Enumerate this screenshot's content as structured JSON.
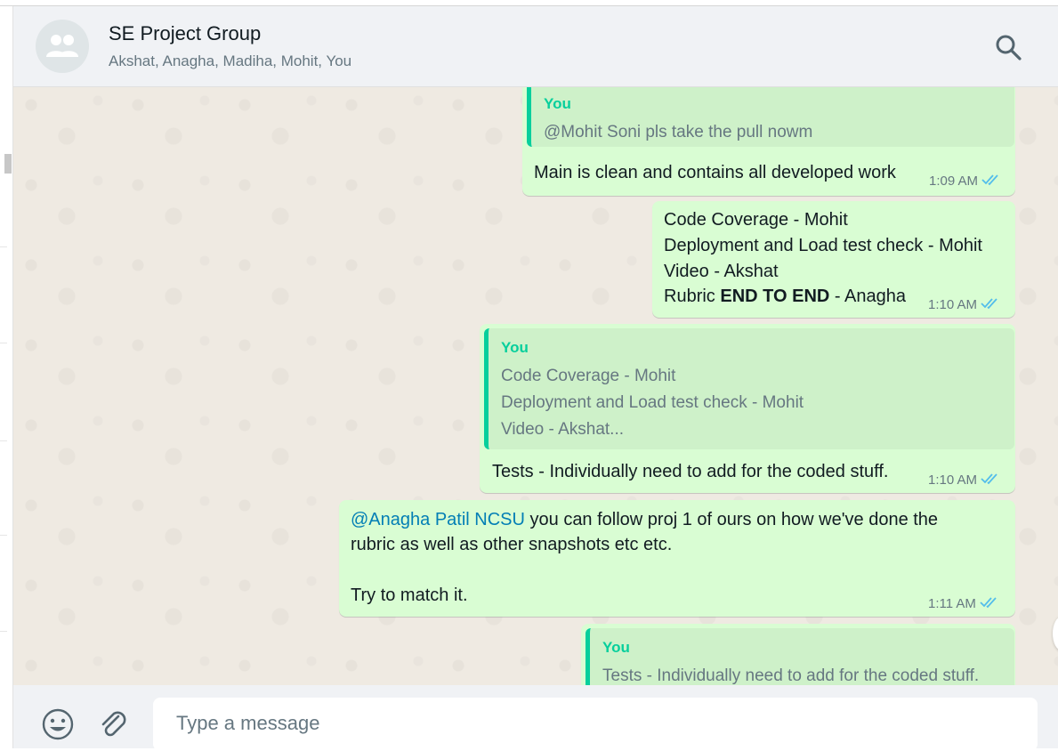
{
  "header": {
    "title": "SE Project Group",
    "subtitle": "Akshat, Anagha, Madiha, Mohit, You",
    "avatar_icon": "group-icon",
    "search_icon": "search-icon"
  },
  "messages": [
    {
      "quote": {
        "author": "You",
        "lines": [
          "@Mohit Soni pls take the pull nowm"
        ]
      },
      "lines": [
        "Main is clean and contains all developed work"
      ],
      "time": "1:09 AM",
      "status": "read"
    },
    {
      "lines": [
        "Code Coverage - Mohit",
        "Deployment and Load test check - Mohit",
        "Video - Akshat"
      ],
      "rich_line": {
        "prefix": "Rubric ",
        "bold": "END TO END",
        "suffix": " - Anagha"
      },
      "time": "1:10 AM",
      "status": "read"
    },
    {
      "quote": {
        "author": "You",
        "lines": [
          "Code Coverage - Mohit",
          "Deployment and Load test check - Mohit",
          "Video - Akshat..."
        ]
      },
      "lines": [
        "Tests - Individually need to add for the coded stuff."
      ],
      "time": "1:10 AM",
      "status": "read"
    },
    {
      "mention": "@Anagha Patil NCSU",
      "lines": [
        " you can follow proj 1 of ours on how we've done the",
        "rubric as well as other snapshots etc etc.",
        "Try to match it."
      ],
      "time": "1:11 AM",
      "status": "read"
    },
    {
      "quote": {
        "author": "You",
        "lines": [
          "Tests - Individually need to add for the coded stuff."
        ]
      }
    }
  ],
  "composer": {
    "placeholder": "Type a message",
    "emoji_icon": "emoji-icon",
    "attach_icon": "paperclip-icon"
  },
  "colors": {
    "outgoing_bubble": "#d9fdd3",
    "quote_accent": "#06cf9c",
    "mention": "#027eb5",
    "read_ticks": "#53bdeb",
    "chat_background": "#efeae2"
  }
}
